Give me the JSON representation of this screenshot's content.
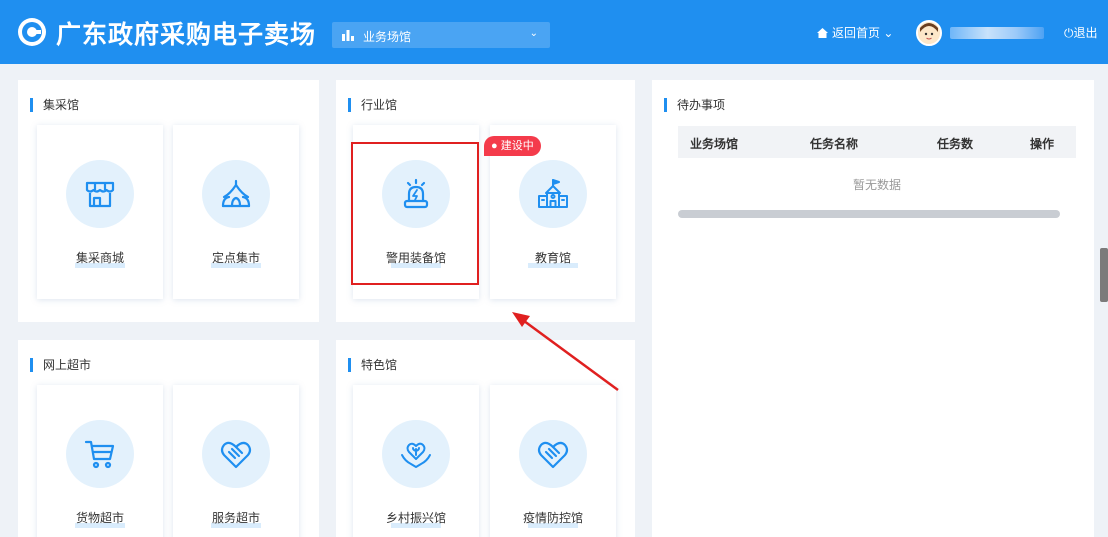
{
  "header": {
    "site_title": "广东政府采购电子卖场",
    "hall_selector": {
      "value": "业务场馆"
    },
    "home_link": "返回首页",
    "logout": "退出",
    "colors": {
      "primary": "#1f8ff0",
      "badge": "#f43b4b",
      "highlight": "#e02020"
    }
  },
  "sections": {
    "jicai": {
      "title": "集采馆",
      "cards": [
        {
          "label": "集采商城",
          "icon": "storefront-icon"
        },
        {
          "label": "定点集市",
          "icon": "tent-icon"
        }
      ]
    },
    "hangye": {
      "title": "行业馆",
      "badge": "建设中",
      "cards": [
        {
          "label": "警用装备馆",
          "icon": "police-siren-icon"
        },
        {
          "label": "教育馆",
          "icon": "school-building-icon"
        }
      ]
    },
    "wangshang": {
      "title": "网上超市",
      "cards": [
        {
          "label": "货物超市",
          "icon": "shopping-cart-icon"
        },
        {
          "label": "服务超市",
          "icon": "handshake-heart-icon"
        }
      ]
    },
    "tese": {
      "title": "特色馆",
      "cards": [
        {
          "label": "乡村振兴馆",
          "icon": "hands-heart-sprout-icon"
        },
        {
          "label": "疫情防控馆",
          "icon": "handshake-heart-icon"
        }
      ]
    }
  },
  "todo": {
    "title": "待办事项",
    "columns": [
      "业务场馆",
      "任务名称",
      "任务数",
      "操作"
    ],
    "empty_text": "暂无数据"
  }
}
